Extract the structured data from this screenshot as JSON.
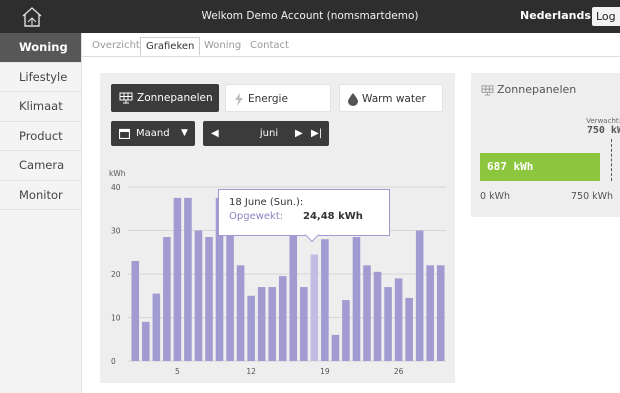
{
  "header": {
    "welcome": "Welkom Demo Account (nomsmartdemo)",
    "language": "Nederlands ▼",
    "logout": "Log uit"
  },
  "sidebar": {
    "items": [
      {
        "label": "Woning",
        "active": true
      },
      {
        "label": "Lifestyle",
        "active": false
      },
      {
        "label": "Klimaat",
        "active": false
      },
      {
        "label": "Product",
        "active": false
      },
      {
        "label": "Camera",
        "active": false
      },
      {
        "label": "Monitor",
        "active": false
      }
    ]
  },
  "tabs": [
    "Overzicht",
    "Grafieken",
    "Woning",
    "Contact"
  ],
  "energy_buttons": {
    "solar": "Zonnepanelen",
    "usage": "Energie verbruikt",
    "water": "Warm water"
  },
  "period": {
    "select": "Maand",
    "month": "juni"
  },
  "tooltip": {
    "date": "18 June (Sun.):",
    "label": "Opgewekt:",
    "value": "24,48 kWh"
  },
  "summary": {
    "title": "Zonnepanelen",
    "expected_label": "Verwacht:",
    "expected_value": "750 kWh",
    "current": "687 kWh",
    "current_value": 687,
    "max_value": 750,
    "scale_min": "0 kWh",
    "scale_max": "750 kWh"
  },
  "colors": {
    "bar": "#a29bd1",
    "bar_highlight": "#c3bde6",
    "accent_purple": "#8c84c4",
    "green": "#8cc63f"
  },
  "chart_data": {
    "type": "bar",
    "ylabel": "kWh",
    "ylim": [
      0,
      40
    ],
    "yticks": [
      0,
      10,
      20,
      30,
      40
    ],
    "xticks": [
      5,
      12,
      19,
      26
    ],
    "x": [
      1,
      2,
      3,
      4,
      5,
      6,
      7,
      8,
      9,
      10,
      11,
      12,
      13,
      14,
      15,
      16,
      17,
      18,
      19,
      20,
      21,
      22,
      23,
      24,
      25,
      26,
      27,
      28,
      29,
      30
    ],
    "values": [
      23,
      9,
      15.5,
      28.5,
      37.5,
      37.5,
      30,
      28.5,
      37.5,
      30,
      22,
      15,
      17,
      17,
      19.5,
      29,
      17,
      24.48,
      28,
      6,
      14,
      28.5,
      22,
      20.5,
      17,
      19,
      14.5,
      30,
      22,
      22
    ],
    "highlight_index": 17,
    "grid": true
  }
}
